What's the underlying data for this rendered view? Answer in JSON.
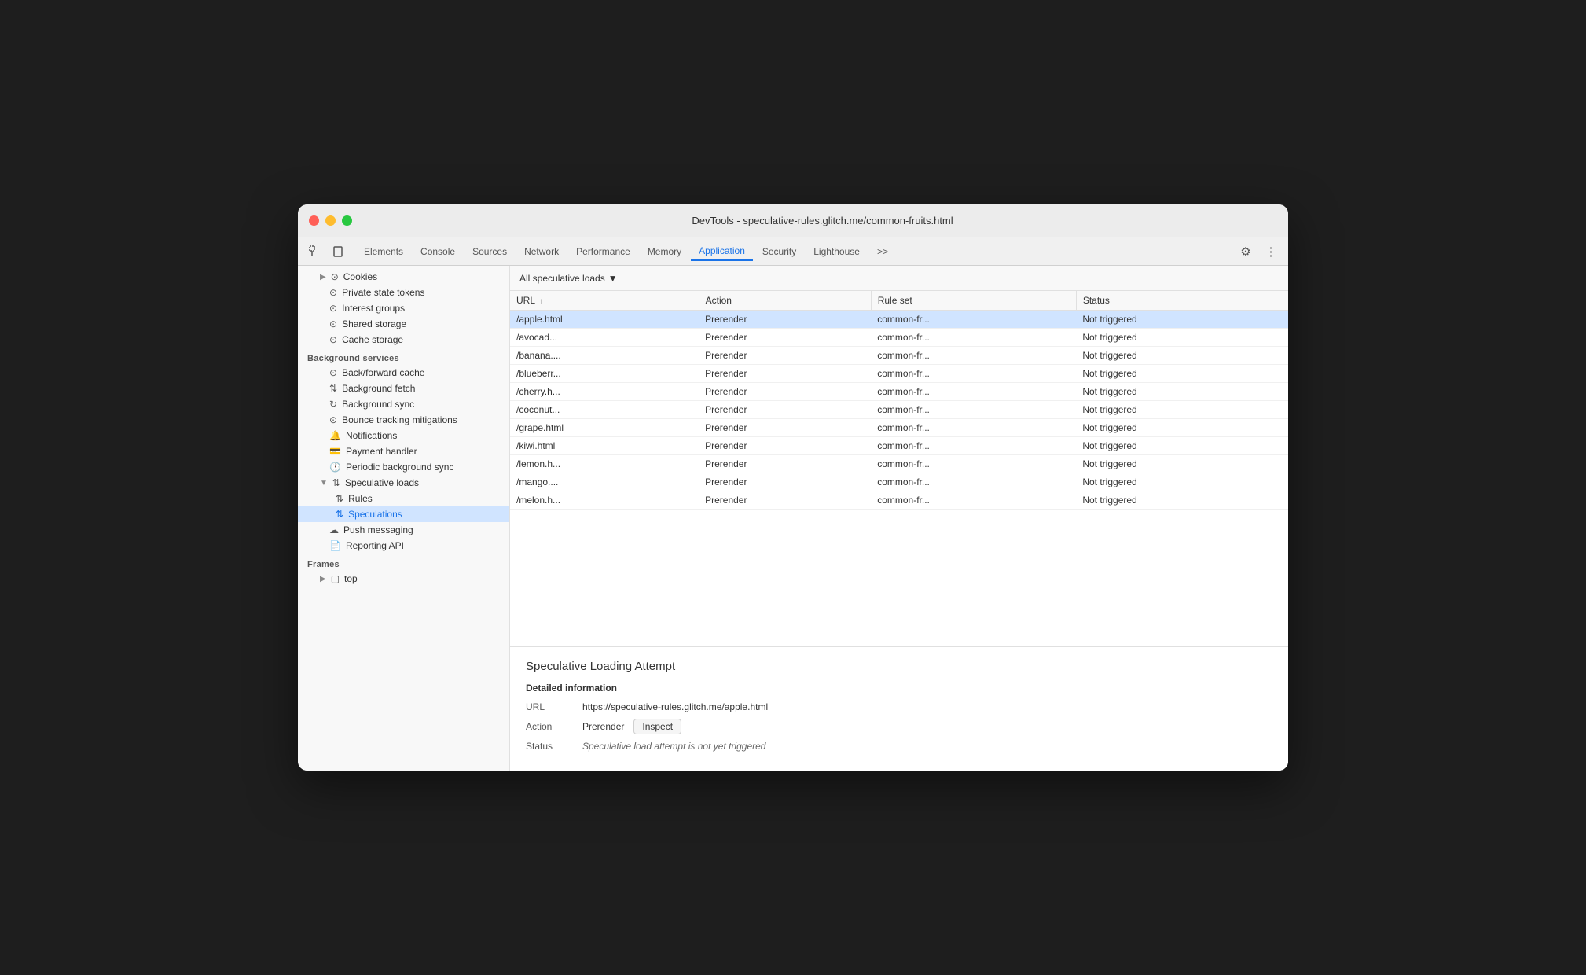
{
  "window": {
    "title": "DevTools - speculative-rules.glitch.me/common-fruits.html"
  },
  "tabs": {
    "items": [
      {
        "label": "Elements",
        "active": false
      },
      {
        "label": "Console",
        "active": false
      },
      {
        "label": "Sources",
        "active": false
      },
      {
        "label": "Network",
        "active": false
      },
      {
        "label": "Performance",
        "active": false
      },
      {
        "label": "Memory",
        "active": false
      },
      {
        "label": "Application",
        "active": true
      },
      {
        "label": "Security",
        "active": false
      },
      {
        "label": "Lighthouse",
        "active": false
      }
    ],
    "more_label": ">>",
    "settings_label": "⚙",
    "more_options_label": "⋮"
  },
  "sidebar": {
    "sections": [
      {
        "id": "storage",
        "items": [
          {
            "label": "Cookies",
            "indent": 1,
            "icon": "▶",
            "has_arrow": true,
            "icon_type": "database"
          },
          {
            "label": "Private state tokens",
            "indent": 1,
            "icon_type": "database"
          },
          {
            "label": "Interest groups",
            "indent": 1,
            "icon_type": "database"
          },
          {
            "label": "Shared storage",
            "indent": 1,
            "icon_type": "database",
            "has_arrow": true
          },
          {
            "label": "Cache storage",
            "indent": 1,
            "icon_type": "database"
          }
        ]
      },
      {
        "id": "background_services",
        "header": "Background services",
        "items": [
          {
            "label": "Back/forward cache",
            "indent": 1,
            "icon_type": "database"
          },
          {
            "label": "Background fetch",
            "indent": 1,
            "icon_type": "arrows"
          },
          {
            "label": "Background sync",
            "indent": 1,
            "icon_type": "sync"
          },
          {
            "label": "Bounce tracking mitigations",
            "indent": 1,
            "icon_type": "database"
          },
          {
            "label": "Notifications",
            "indent": 1,
            "icon_type": "bell"
          },
          {
            "label": "Payment handler",
            "indent": 1,
            "icon_type": "card"
          },
          {
            "label": "Periodic background sync",
            "indent": 1,
            "icon_type": "clock"
          },
          {
            "label": "Speculative loads",
            "indent": 1,
            "icon_type": "arrows",
            "expanded": true,
            "active_parent": true
          },
          {
            "label": "Rules",
            "indent": 2,
            "icon_type": "arrows"
          },
          {
            "label": "Speculations",
            "indent": 2,
            "icon_type": "arrows",
            "active": true
          },
          {
            "label": "Push messaging",
            "indent": 1,
            "icon_type": "cloud"
          },
          {
            "label": "Reporting API",
            "indent": 1,
            "icon_type": "doc"
          }
        ]
      },
      {
        "id": "frames",
        "header": "Frames",
        "items": [
          {
            "label": "top",
            "indent": 1,
            "icon_type": "frame",
            "has_arrow": true
          }
        ]
      }
    ]
  },
  "filter": {
    "label": "All speculative loads",
    "arrow": "▼"
  },
  "table": {
    "columns": [
      {
        "id": "url",
        "label": "URL",
        "sort": "↑"
      },
      {
        "id": "action",
        "label": "Action"
      },
      {
        "id": "ruleset",
        "label": "Rule set"
      },
      {
        "id": "status",
        "label": "Status"
      }
    ],
    "rows": [
      {
        "url": "/apple.html",
        "action": "Prerender",
        "ruleset": "common-fr...",
        "status": "Not triggered",
        "selected": true
      },
      {
        "url": "/avocad...",
        "action": "Prerender",
        "ruleset": "common-fr...",
        "status": "Not triggered"
      },
      {
        "url": "/banana....",
        "action": "Prerender",
        "ruleset": "common-fr...",
        "status": "Not triggered"
      },
      {
        "url": "/blueberr...",
        "action": "Prerender",
        "ruleset": "common-fr...",
        "status": "Not triggered"
      },
      {
        "url": "/cherry.h...",
        "action": "Prerender",
        "ruleset": "common-fr...",
        "status": "Not triggered"
      },
      {
        "url": "/coconut...",
        "action": "Prerender",
        "ruleset": "common-fr...",
        "status": "Not triggered"
      },
      {
        "url": "/grape.html",
        "action": "Prerender",
        "ruleset": "common-fr...",
        "status": "Not triggered"
      },
      {
        "url": "/kiwi.html",
        "action": "Prerender",
        "ruleset": "common-fr...",
        "status": "Not triggered"
      },
      {
        "url": "/lemon.h...",
        "action": "Prerender",
        "ruleset": "common-fr...",
        "status": "Not triggered"
      },
      {
        "url": "/mango....",
        "action": "Prerender",
        "ruleset": "common-fr...",
        "status": "Not triggered"
      },
      {
        "url": "/melon.h...",
        "action": "Prerender",
        "ruleset": "common-fr...",
        "status": "Not triggered"
      }
    ]
  },
  "detail": {
    "title": "Speculative Loading Attempt",
    "section_header": "Detailed information",
    "url_label": "URL",
    "url_value": "https://speculative-rules.glitch.me/apple.html",
    "action_label": "Action",
    "action_value": "Prerender",
    "inspect_btn": "Inspect",
    "status_label": "Status",
    "status_value": "Speculative load attempt is not yet triggered"
  },
  "icons": {
    "cursor": "⬚",
    "box": "⬜",
    "settings": "⚙",
    "more": "⋮"
  }
}
